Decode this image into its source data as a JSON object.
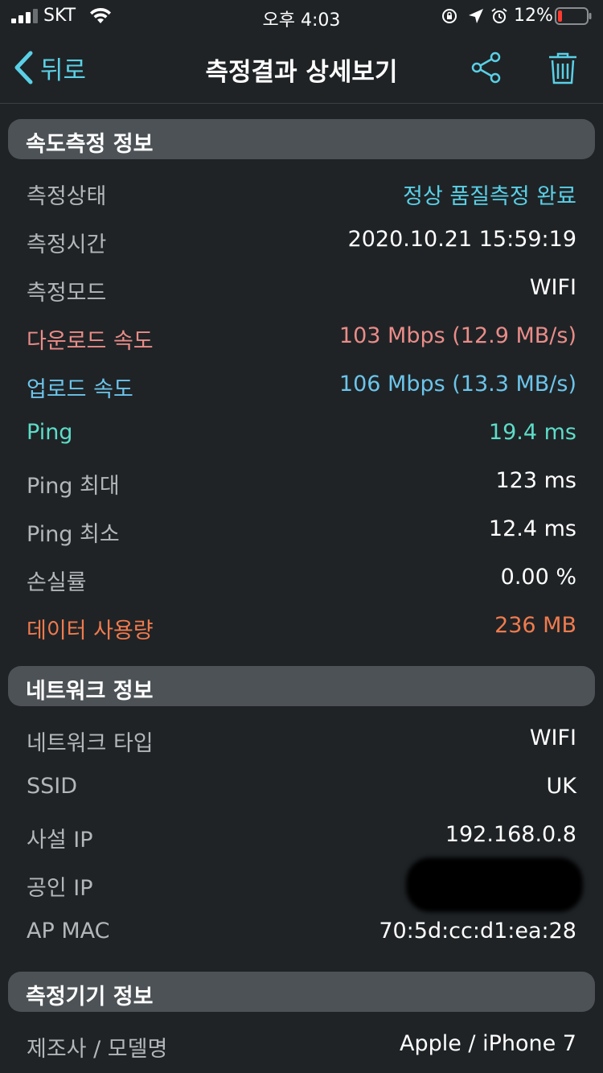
{
  "status_bar": {
    "carrier": "SKT",
    "time": "오후 4:03",
    "battery": "12%"
  },
  "nav": {
    "back_label": "뒤로",
    "title": "측정결과 상세보기",
    "icons": [
      "share-icon",
      "trash-icon"
    ]
  },
  "colors": {
    "accent_cyan": "#5ad0e6",
    "download": "#ea8c88",
    "upload": "#6cc4ea",
    "ping": "#5edcc8",
    "data_usage": "#f07b4e"
  },
  "sections": {
    "speed": {
      "title": "속도측정 정보",
      "rows": [
        {
          "label": "측정상태",
          "value": "정상 품질측정 완료"
        },
        {
          "label": "측정시간",
          "value": "2020.10.21 15:59:19"
        },
        {
          "label": "측정모드",
          "value": "WIFI"
        },
        {
          "label": "다운로드 속도",
          "value": "103 Mbps (12.9 MB/s)"
        },
        {
          "label": "업로드 속도",
          "value": "106 Mbps (13.3 MB/s)"
        },
        {
          "label": "Ping",
          "value": "19.4 ms"
        },
        {
          "label": "Ping 최대",
          "value": "123 ms"
        },
        {
          "label": "Ping 최소",
          "value": "12.4 ms"
        },
        {
          "label": "손실률",
          "value": "0.00 %"
        },
        {
          "label": "데이터 사용량",
          "value": "236 MB"
        }
      ]
    },
    "network": {
      "title": "네트워크 정보",
      "rows": [
        {
          "label": "네트워크 타입",
          "value": "WIFI"
        },
        {
          "label": "SSID",
          "value": "UK"
        },
        {
          "label": "사설 IP",
          "value": "192.168.0.8"
        },
        {
          "label": "공인 IP",
          "value": ""
        },
        {
          "label": "AP MAC",
          "value": "70:5d:cc:d1:ea:28"
        }
      ]
    },
    "device": {
      "title": "측정기기 정보",
      "rows": [
        {
          "label": "제조사 / 모델명",
          "value": "Apple / iPhone 7"
        }
      ]
    }
  }
}
